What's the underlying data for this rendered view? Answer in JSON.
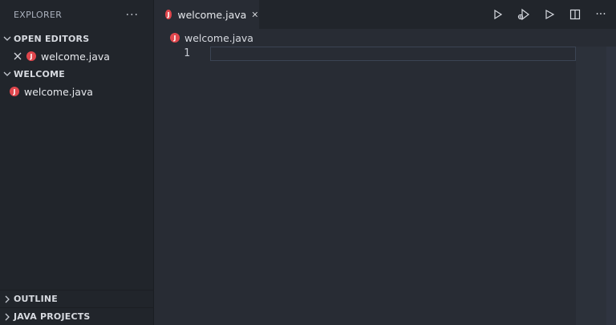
{
  "sidebar": {
    "title": "EXPLORER",
    "more_icon": "···",
    "sections": {
      "open_editors": {
        "label": "OPEN EDITORS",
        "file": "welcome.java",
        "badge": "J"
      },
      "welcome": {
        "label": "WELCOME",
        "file": "welcome.java",
        "badge": "J"
      },
      "outline": {
        "label": "OUTLINE"
      },
      "java_projects": {
        "label": "JAVA PROJECTS"
      }
    }
  },
  "editor": {
    "tab": {
      "label": "welcome.java",
      "badge": "J"
    },
    "actions": [
      "run-icon",
      "debug-run-icon",
      "run-alt-icon",
      "split-editor-icon",
      "more-icon"
    ],
    "more_label": "···",
    "breadcrumb": {
      "label": "welcome.java",
      "badge": "J"
    },
    "line_numbers": [
      "1"
    ]
  },
  "colors": {
    "java_badge": "#e0474d",
    "sidebar_bg": "#21252b",
    "editor_bg": "#282c34"
  }
}
